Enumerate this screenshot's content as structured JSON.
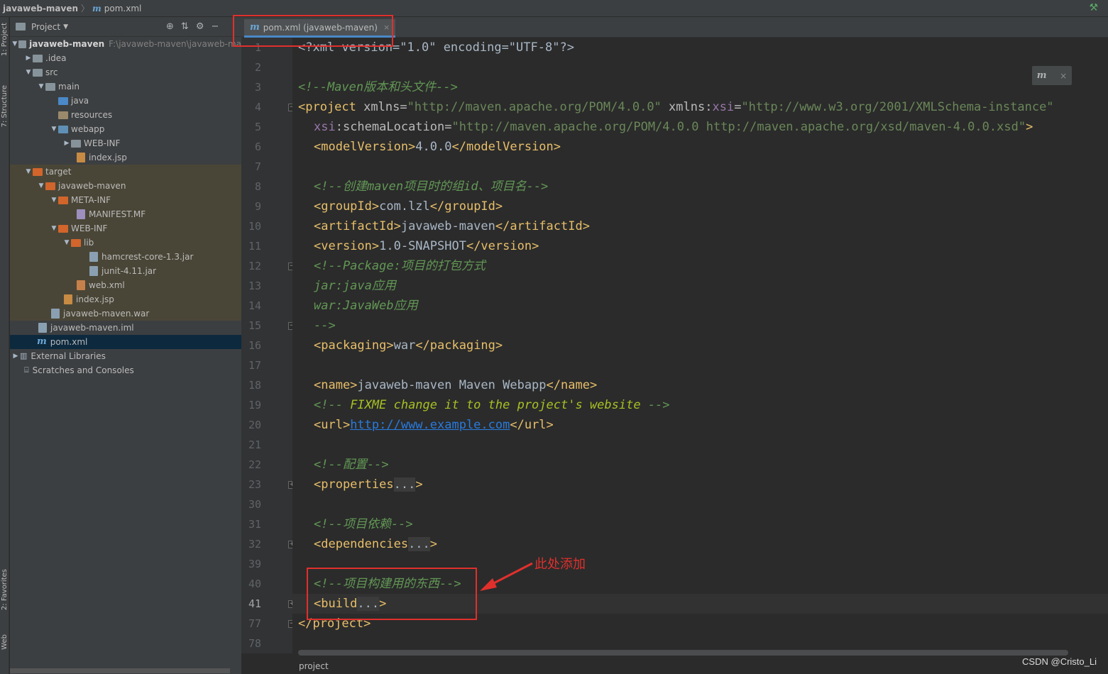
{
  "breadcrumb": {
    "project": "javaweb-maven",
    "file_glyph": "m",
    "file": "pom.xml"
  },
  "tool_strip": {
    "project": "1: Project",
    "structure": "7: Structure",
    "favorites": "2: Favorites",
    "web": "Web"
  },
  "project_panel": {
    "title": "Project",
    "tree": [
      {
        "label": "javaweb-maven",
        "path": "F:\\javaweb-maven\\javaweb-ma"
      },
      {
        "label": ".idea"
      },
      {
        "label": "src"
      },
      {
        "label": "main"
      },
      {
        "label": "java"
      },
      {
        "label": "resources"
      },
      {
        "label": "webapp"
      },
      {
        "label": "WEB-INF"
      },
      {
        "label": "index.jsp"
      },
      {
        "label": "target"
      },
      {
        "label": "javaweb-maven"
      },
      {
        "label": "META-INF"
      },
      {
        "label": "MANIFEST.MF"
      },
      {
        "label": "WEB-INF"
      },
      {
        "label": "lib"
      },
      {
        "label": "hamcrest-core-1.3.jar"
      },
      {
        "label": "junit-4.11.jar"
      },
      {
        "label": "web.xml"
      },
      {
        "label": "index.jsp"
      },
      {
        "label": "javaweb-maven.war"
      },
      {
        "label": "javaweb-maven.iml"
      },
      {
        "label": "pom.xml"
      },
      {
        "label": "External Libraries"
      },
      {
        "label": "Scratches and Consoles"
      }
    ]
  },
  "editor": {
    "tab_label": "pom.xml (javaweb-maven)",
    "line_numbers": [
      "1",
      "2",
      "3",
      "4",
      "5",
      "6",
      "7",
      "8",
      "9",
      "10",
      "11",
      "12",
      "13",
      "14",
      "15",
      "16",
      "17",
      "18",
      "19",
      "20",
      "21",
      "22",
      "23",
      "30",
      "31",
      "32",
      "39",
      "40",
      "41",
      "77",
      "78"
    ],
    "code": {
      "xml_decl": "<?xml version=\"1.0\" encoding=\"UTF-8\"?>",
      "c_header": "<!--Maven版本和头文件-->",
      "project_open_a": "<project ",
      "xmlns": "xmlns",
      "xmlns_val": "\"http://maven.apache.org/POM/4.0.0\"",
      "xmlns_xsi": "xmlns:",
      "xsi": "xsi",
      "xsi_val": "\"http://www.w3.org/2001/XMLSchema-instance\"",
      "schema_attr": ":schemaLocation",
      "schema_val": "\"http://maven.apache.org/POM/4.0.0 http://maven.apache.org/xsd/maven-4.0.0.xsd\"",
      "model_open": "<modelVersion>",
      "model_val": "4.0.0",
      "model_close": "</modelVersion>",
      "c_gid": "<!--创建maven项目时的组id、项目名-->",
      "gid_open": "<groupId>",
      "gid_val": "com.lzl",
      "gid_close": "</groupId>",
      "aid_open": "<artifactId>",
      "aid_val": "javaweb-maven",
      "aid_close": "</artifactId>",
      "ver_open": "<version>",
      "ver_val": "1.0-SNAPSHOT",
      "ver_close": "</version>",
      "c_pkg1": "<!--Package:项目的打包方式",
      "c_pkg2": "jar:java应用",
      "c_pkg3": "war:JavaWeb应用",
      "c_pkg4": "-->",
      "pack_open": "<packaging>",
      "pack_val": "war",
      "pack_close": "</packaging>",
      "name_open": "<name>",
      "name_val": "javaweb-maven Maven Webapp",
      "name_close": "</name>",
      "c_fixme_a": "<!-- ",
      "c_fixme_b": "FIXME change it to the project's website",
      "c_fixme_c": " -->",
      "url_open": "<url>",
      "url_val": "http://www.example.com",
      "url_close": "</url>",
      "c_cfg": "<!--配置-->",
      "props": "<properties",
      "c_dep": "<!--项目依赖-->",
      "deps": "<dependencies",
      "c_build": "<!--项目构建用的东西-->",
      "build": "<build",
      "ellipsis": "...",
      "gt": ">",
      "project_close": "</project>"
    }
  },
  "maven_popup_glyph": "m",
  "annotation": "此处添加",
  "status_crumb": "project",
  "watermark": "CSDN @Cristo_Li",
  "colors": {
    "red_highlight": "#e0302c",
    "tag": "#e8bf6a",
    "comment": "#629755",
    "string": "#6a8759"
  }
}
